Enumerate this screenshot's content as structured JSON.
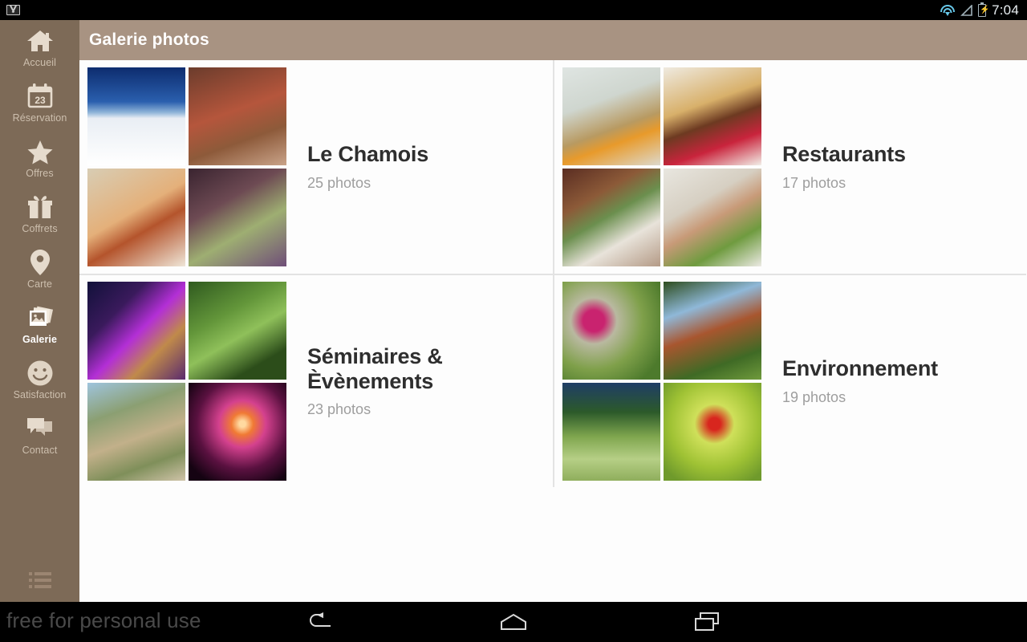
{
  "statusbar": {
    "notification_icon": "gmail-icon",
    "wifi_icon": "wifi-icon",
    "signal_icon": "signal-triangle-icon",
    "battery_icon": "battery-charging-icon",
    "time": "7:04"
  },
  "sidebar": {
    "background_color": "#7d6a57",
    "items": [
      {
        "label": "Accueil",
        "icon": "home-icon",
        "active": false
      },
      {
        "label": "Réservation",
        "icon": "calendar-icon",
        "active": false,
        "badge": "23"
      },
      {
        "label": "Offres",
        "icon": "star-icon",
        "active": false
      },
      {
        "label": "Coffrets",
        "icon": "gift-icon",
        "active": false
      },
      {
        "label": "Carte",
        "icon": "map-pin-icon",
        "active": false
      },
      {
        "label": "Galerie",
        "icon": "photos-icon",
        "active": true
      },
      {
        "label": "Satisfaction",
        "icon": "smiley-icon",
        "active": false
      },
      {
        "label": "Contact",
        "icon": "chat-bubble-icon",
        "active": false
      }
    ],
    "menu_icon": "list-menu-icon"
  },
  "header": {
    "title": "Galerie photos",
    "background_color": "#a89382"
  },
  "gallery": {
    "albums": [
      {
        "title": "Le Chamois",
        "count": "25 photos"
      },
      {
        "title": "Restaurants",
        "count": "17 photos"
      },
      {
        "title": "Séminaires &\nÈvènements",
        "count": "23 photos"
      },
      {
        "title": "Environnement",
        "count": "19 photos"
      }
    ]
  },
  "navbar": {
    "watermark": "free for personal use",
    "buttons": [
      {
        "name": "back-button",
        "icon": "back-arrow-icon"
      },
      {
        "name": "home-button",
        "icon": "home-pentagon-icon"
      },
      {
        "name": "recents-button",
        "icon": "recents-icon"
      }
    ]
  }
}
